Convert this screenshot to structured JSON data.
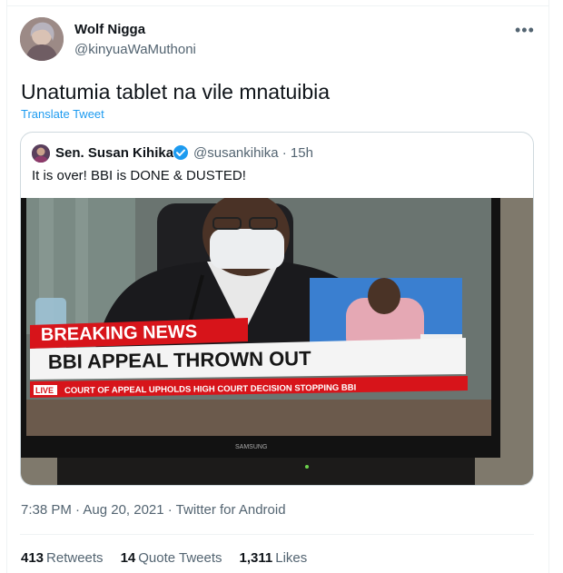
{
  "author": {
    "name": "Wolf Nigga",
    "handle": "@kinyuaWaMuthoni"
  },
  "more_icon": "more-horizontal-icon",
  "tweet": {
    "text": "Unatumia tablet na vile mnatuibia",
    "translate_label": "Translate Tweet"
  },
  "quoted": {
    "name": "Sen. Susan Kihika",
    "verified_icon": "verified-badge-icon",
    "handle_time": "@susankihika · 15h",
    "text": "It is over! BBI is DONE & DUSTED!",
    "image": {
      "banner_top": "BREAKING NEWS",
      "banner_main": "BBI APPEAL THROWN OUT",
      "ticker_live": "LIVE",
      "ticker_text": "COURT OF APPEAL UPHOLDS HIGH COURT DECISION STOPPING BBI",
      "tv_brand": "SAMSUNG"
    }
  },
  "meta": "7:38 PM · Aug 20, 2021 · Twitter for Android",
  "stats": {
    "retweets_count": "413",
    "retweets_label": "Retweets",
    "quotes_count": "14",
    "quotes_label": "Quote Tweets",
    "likes_count": "1,311",
    "likes_label": "Likes"
  },
  "colors": {
    "link": "#1d9bf0",
    "secondary_text": "#536471",
    "breaking_red": "#d7141a"
  }
}
